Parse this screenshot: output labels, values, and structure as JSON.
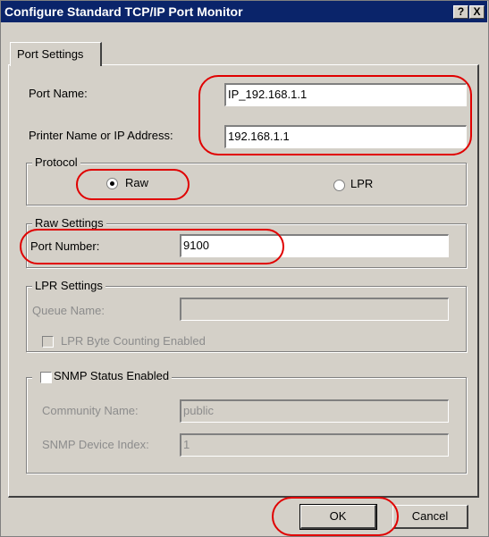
{
  "window": {
    "title": "Configure Standard TCP/IP Port Monitor",
    "help_label": "?",
    "close_label": "X"
  },
  "tabs": [
    {
      "label": "Port Settings"
    }
  ],
  "port": {
    "name_label": "Port Name:",
    "name_value": "IP_192.168.1.1",
    "address_label": "Printer Name or IP Address:",
    "address_value": "192.168.1.1"
  },
  "protocol": {
    "legend": "Protocol",
    "raw_label": "Raw",
    "lpr_label": "LPR",
    "selected": "Raw"
  },
  "raw_settings": {
    "legend": "Raw Settings",
    "port_number_label": "Port Number:",
    "port_number_value": "9100"
  },
  "lpr_settings": {
    "legend": "LPR Settings",
    "queue_name_label": "Queue Name:",
    "queue_name_value": "",
    "byte_counting_label": "LPR Byte Counting Enabled"
  },
  "snmp": {
    "enabled_label": "SNMP Status Enabled",
    "community_label": "Community Name:",
    "community_value": "public",
    "device_index_label": "SNMP Device Index:",
    "device_index_value": "1"
  },
  "buttons": {
    "ok": "OK",
    "cancel": "Cancel"
  },
  "colors": {
    "title_bar": "#0a246a",
    "dialog_face": "#d4d0c8",
    "annotation": "#e00000"
  }
}
